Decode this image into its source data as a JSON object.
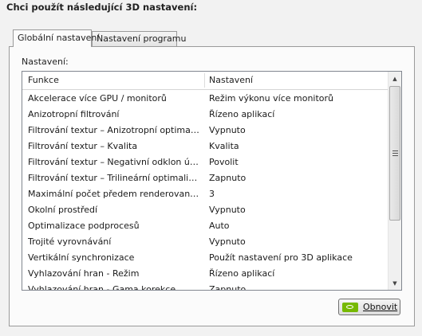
{
  "heading": "Chci použít následující 3D nastavení:",
  "tabs": [
    {
      "label": "Globální nastavení",
      "active": true
    },
    {
      "label": "Nastavení programu",
      "active": false
    }
  ],
  "panel": {
    "section_label": "Nastavení:",
    "columns": {
      "feature": "Funkce",
      "setting": "Nastavení"
    },
    "rows": [
      {
        "feature": "Akcelerace více GPU / monitorů",
        "setting": "Režim výkonu více monitorů"
      },
      {
        "feature": "Anizotropní filtrování",
        "setting": "Řízeno aplikací"
      },
      {
        "feature": "Filtrování textur – Anizotropní optimalizac...",
        "setting": "Vypnuto"
      },
      {
        "feature": "Filtrování textur – Kvalita",
        "setting": "Kvalita"
      },
      {
        "feature": "Filtrování textur – Negativní odklon úrovn...",
        "setting": "Povolit"
      },
      {
        "feature": "Filtrování textur – Trilineární optimalizace",
        "setting": "Zapnuto"
      },
      {
        "feature": "Maximální počet předem renderovaných s...",
        "setting": "3"
      },
      {
        "feature": "Okolní prostředí",
        "setting": "Vypnuto"
      },
      {
        "feature": "Optimalizace podprocesů",
        "setting": "Auto"
      },
      {
        "feature": "Trojité vyrovnávání",
        "setting": "Vypnuto"
      },
      {
        "feature": "Vertikální synchronizace",
        "setting": "Použít nastavení pro 3D aplikace"
      },
      {
        "feature": "Vyhlazování hran - Režim",
        "setting": "Řízeno aplikací"
      },
      {
        "feature": "Vyhlazování hran - Gama korekce",
        "setting": "Zapnuto"
      }
    ],
    "refresh_button": "Obnovit"
  },
  "icons": {
    "scroll_up": "▲",
    "scroll_down": "▼",
    "refresh": "nvidia-logo-icon"
  },
  "colors": {
    "nvidia_green": "#76b900"
  }
}
